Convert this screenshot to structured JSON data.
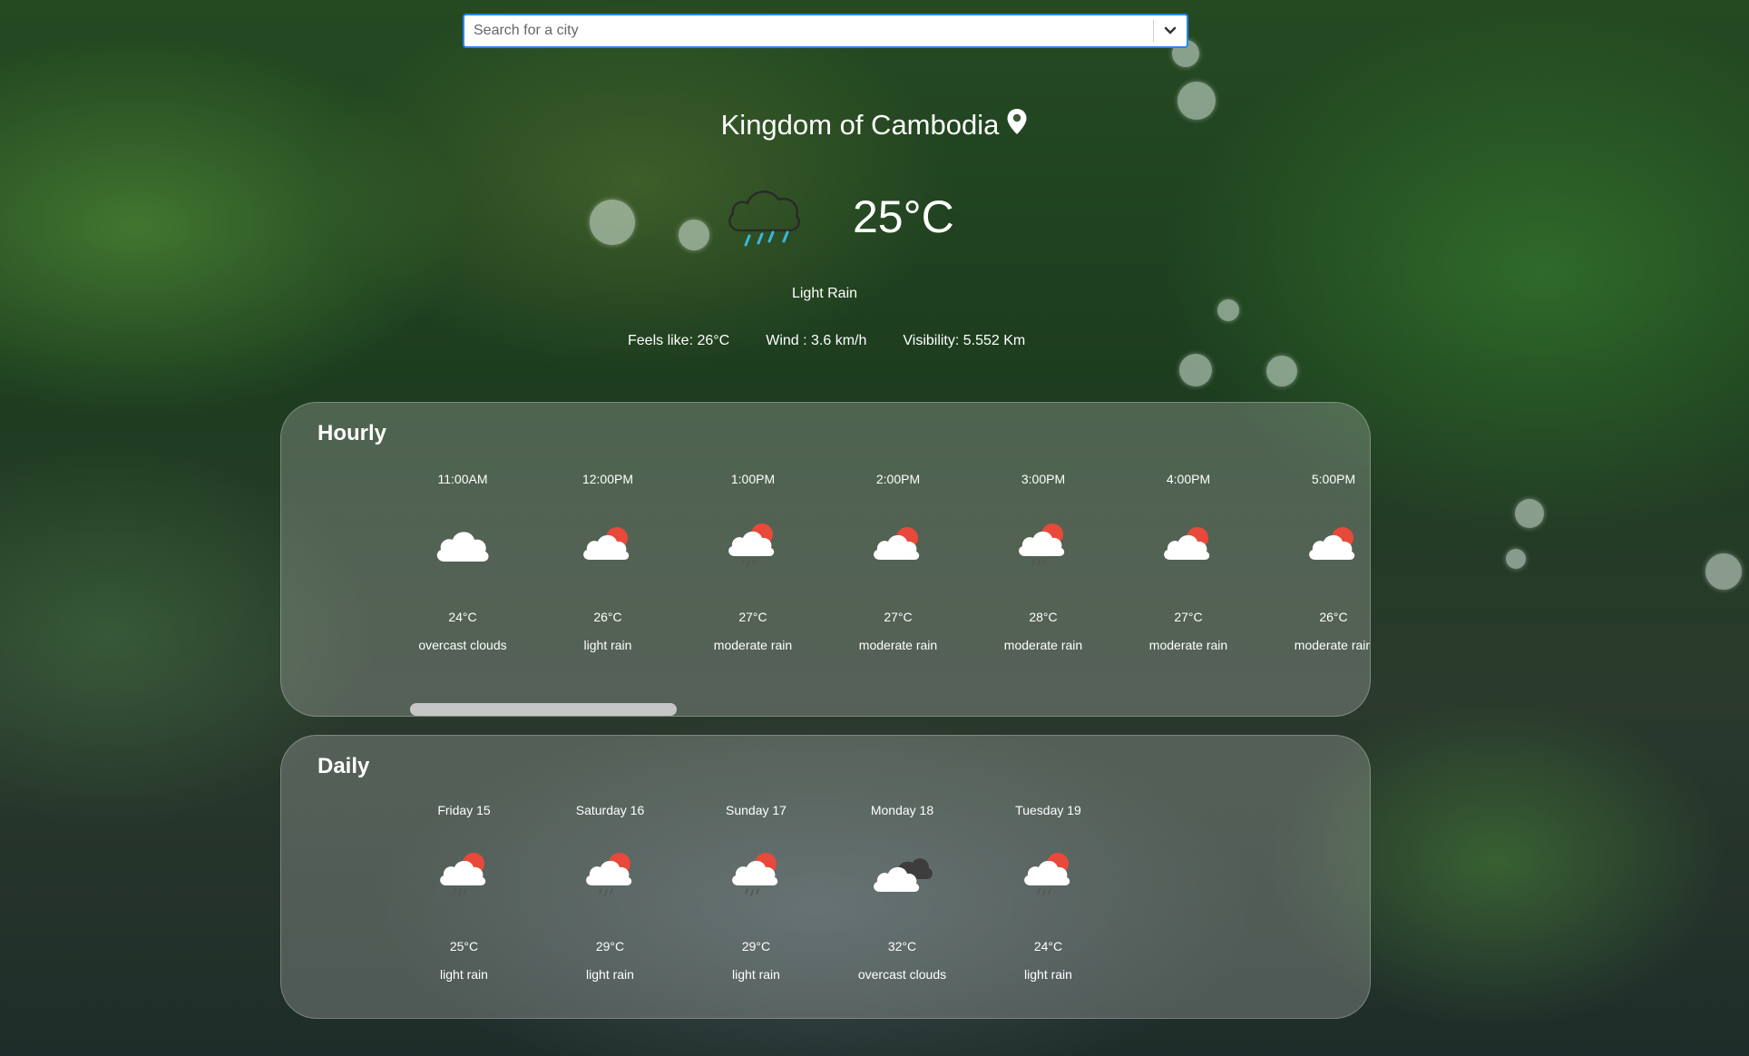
{
  "search": {
    "placeholder": "Search for a city",
    "value": "",
    "dropdown_icon": "chevron-down-icon"
  },
  "current": {
    "location": "Kingdom of Cambodia",
    "location_icon": "map-pin-icon",
    "weather_icon": "rain-cloud-icon",
    "temperature": "25°C",
    "description": "Light Rain",
    "feels_like": "Feels like: 26°C",
    "wind": "Wind : 3.6 km/h",
    "visibility": "Visibility: 5.552 Km"
  },
  "hourly": {
    "title": "Hourly",
    "items": [
      {
        "time": "11:00AM",
        "icon": "cloud-icon",
        "temp": "24°C",
        "desc": "overcast clouds"
      },
      {
        "time": "12:00PM",
        "icon": "sun-cloud-icon",
        "temp": "26°C",
        "desc": "light rain"
      },
      {
        "time": "1:00PM",
        "icon": "sun-cloud-rain-icon",
        "temp": "27°C",
        "desc": "moderate rain"
      },
      {
        "time": "2:00PM",
        "icon": "sun-cloud-icon",
        "temp": "27°C",
        "desc": "moderate rain"
      },
      {
        "time": "3:00PM",
        "icon": "sun-cloud-rain-icon",
        "temp": "28°C",
        "desc": "moderate rain"
      },
      {
        "time": "4:00PM",
        "icon": "sun-cloud-icon",
        "temp": "27°C",
        "desc": "moderate rain"
      },
      {
        "time": "5:00PM",
        "icon": "sun-cloud-icon",
        "temp": "26°C",
        "desc": "moderate rain"
      }
    ]
  },
  "daily": {
    "title": "Daily",
    "items": [
      {
        "day": "Friday 15",
        "icon": "sun-cloud-rain-icon",
        "temp": "25°C",
        "desc": "light rain"
      },
      {
        "day": "Saturday 16",
        "icon": "sun-cloud-rain-icon",
        "temp": "29°C",
        "desc": "light rain"
      },
      {
        "day": "Sunday 17",
        "icon": "sun-cloud-rain-icon",
        "temp": "29°C",
        "desc": "light rain"
      },
      {
        "day": "Monday 18",
        "icon": "dark-clouds-icon",
        "temp": "32°C",
        "desc": "overcast clouds"
      },
      {
        "day": "Tuesday 19",
        "icon": "sun-cloud-rain-icon",
        "temp": "24°C",
        "desc": "light rain"
      }
    ]
  },
  "colors": {
    "search_border": "#2684ff",
    "sun": "#e8493a",
    "cloud": "#ffffff",
    "dark_cloud": "#3d3d3d",
    "rain": "#3bb7e0"
  }
}
